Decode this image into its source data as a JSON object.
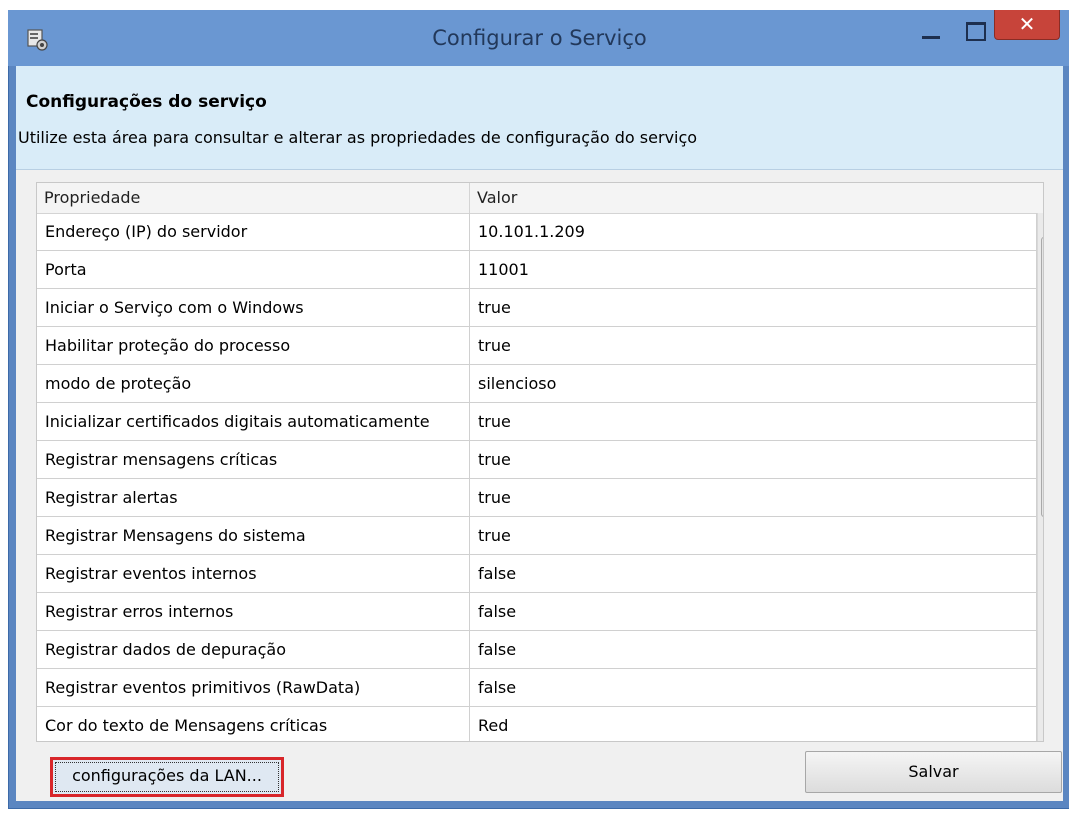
{
  "window": {
    "title": "Configurar o Serviço",
    "close_glyph": "✕"
  },
  "header": {
    "heading": "Configurações do serviço",
    "description": "Utilize esta área para consultar e alterar as propriedades de configuração do serviço"
  },
  "grid": {
    "columns": [
      "Propriedade",
      "Valor"
    ],
    "rows": [
      {
        "property": "Endereço (IP) do servidor",
        "value": "10.101.1.209"
      },
      {
        "property": "Porta",
        "value": "11001"
      },
      {
        "property": "Iniciar o Serviço com o Windows",
        "value": "true"
      },
      {
        "property": "Habilitar proteção do processo",
        "value": "true"
      },
      {
        "property": "modo de proteção",
        "value": "silencioso"
      },
      {
        "property": "Inicializar certificados digitais automaticamente",
        "value": "true"
      },
      {
        "property": "Registrar mensagens críticas",
        "value": "true"
      },
      {
        "property": "Registrar alertas",
        "value": "true"
      },
      {
        "property": "Registrar Mensagens do sistema",
        "value": "true"
      },
      {
        "property": "Registrar eventos internos",
        "value": "false"
      },
      {
        "property": "Registrar erros internos",
        "value": "false"
      },
      {
        "property": "Registrar dados de depuração",
        "value": "false"
      },
      {
        "property": "Registrar eventos primitivos (RawData)",
        "value": "false"
      },
      {
        "property": "Cor do texto de Mensagens críticas",
        "value": "Red"
      }
    ]
  },
  "buttons": {
    "lan": "configurações da LAN...",
    "save": "Salvar"
  },
  "icons": {
    "app": "settings-app-icon",
    "minimize": "minimize-icon",
    "maximize": "maximize-icon",
    "close": "close-icon"
  },
  "colors": {
    "titlebar": "#6a97d2",
    "header_bg": "#d9ecf8",
    "close_button": "#c7443a",
    "highlight_border": "#d8262a"
  }
}
